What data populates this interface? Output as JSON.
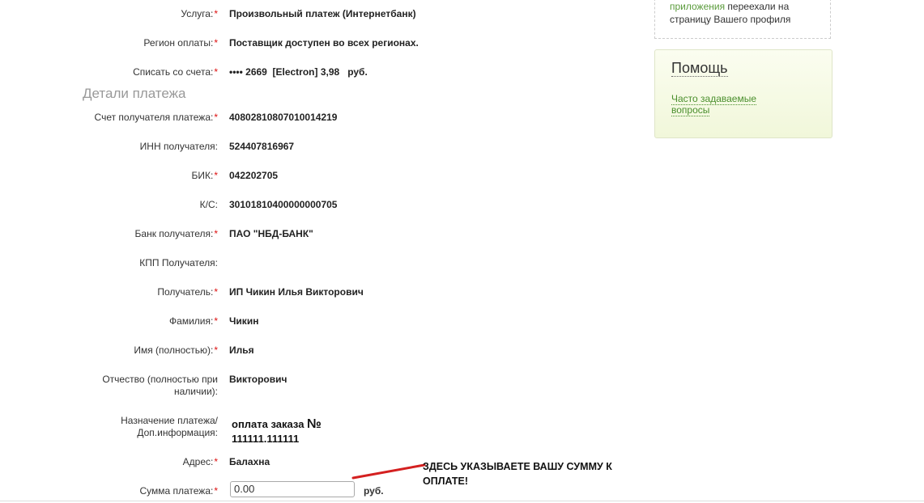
{
  "sidebar": {
    "notice_link": "приложения",
    "notice_line1_rest": " переехали на",
    "notice_line2": "страницу Вашего профиля",
    "help": {
      "title": "Помощь",
      "link_line1": "Часто задаваемые",
      "link_line2": "вопросы"
    }
  },
  "form": {
    "required_mark": "*",
    "service": {
      "label": "Услуга:",
      "value": "Произвольный платеж (Интернетбанк)"
    },
    "region": {
      "label": "Регион оплаты:",
      "value": "Поставщик доступен во всех регионах."
    },
    "account": {
      "label": "Списать со счета:",
      "value": "•••• 2669  [Electron] 3,98   руб."
    },
    "details_title": "Детали платежа",
    "recipient_account": {
      "label": "Счет получателя платежа:",
      "value": "40802810807010014219"
    },
    "inn": {
      "label": "ИНН получателя:",
      "value": "524407816967"
    },
    "bik": {
      "label": "БИК:",
      "value": "042202705"
    },
    "ks": {
      "label": "К/С:",
      "value": "30101810400000000705"
    },
    "bank": {
      "label": "Банк получателя:",
      "value": "ПАО \"НБД-БАНК\""
    },
    "kpp": {
      "label": "КПП Получателя:",
      "value": ""
    },
    "recipient": {
      "label": "Получатель:",
      "value": "ИП Чикин Илья Викторович"
    },
    "surname": {
      "label": "Фамилия:",
      "value": "Чикин"
    },
    "name": {
      "label": "Имя (полностью):",
      "value": "Илья"
    },
    "patronymic": {
      "label_line1": "Отчество (полностью при",
      "label_line2": "наличии):",
      "value": "Викторович"
    },
    "purpose": {
      "label_line1": "Назначение платежа/",
      "label_line2": "Доп.информация:",
      "value_line1": "оплата заказа ",
      "value_sign": "№",
      "value_line2": "111111.111111"
    },
    "address": {
      "label": "Адрес:",
      "value": "Балахна"
    },
    "amount": {
      "label": "Сумма платежа:",
      "value": "0.00",
      "currency": "руб."
    }
  },
  "annotation": {
    "line1": "ЗДЕСЬ УКАЗЫВАЕТЕ ВАШУ СУММУ К",
    "line2": "ОПЛАТЕ!",
    "arrow_color": "#d42020"
  }
}
